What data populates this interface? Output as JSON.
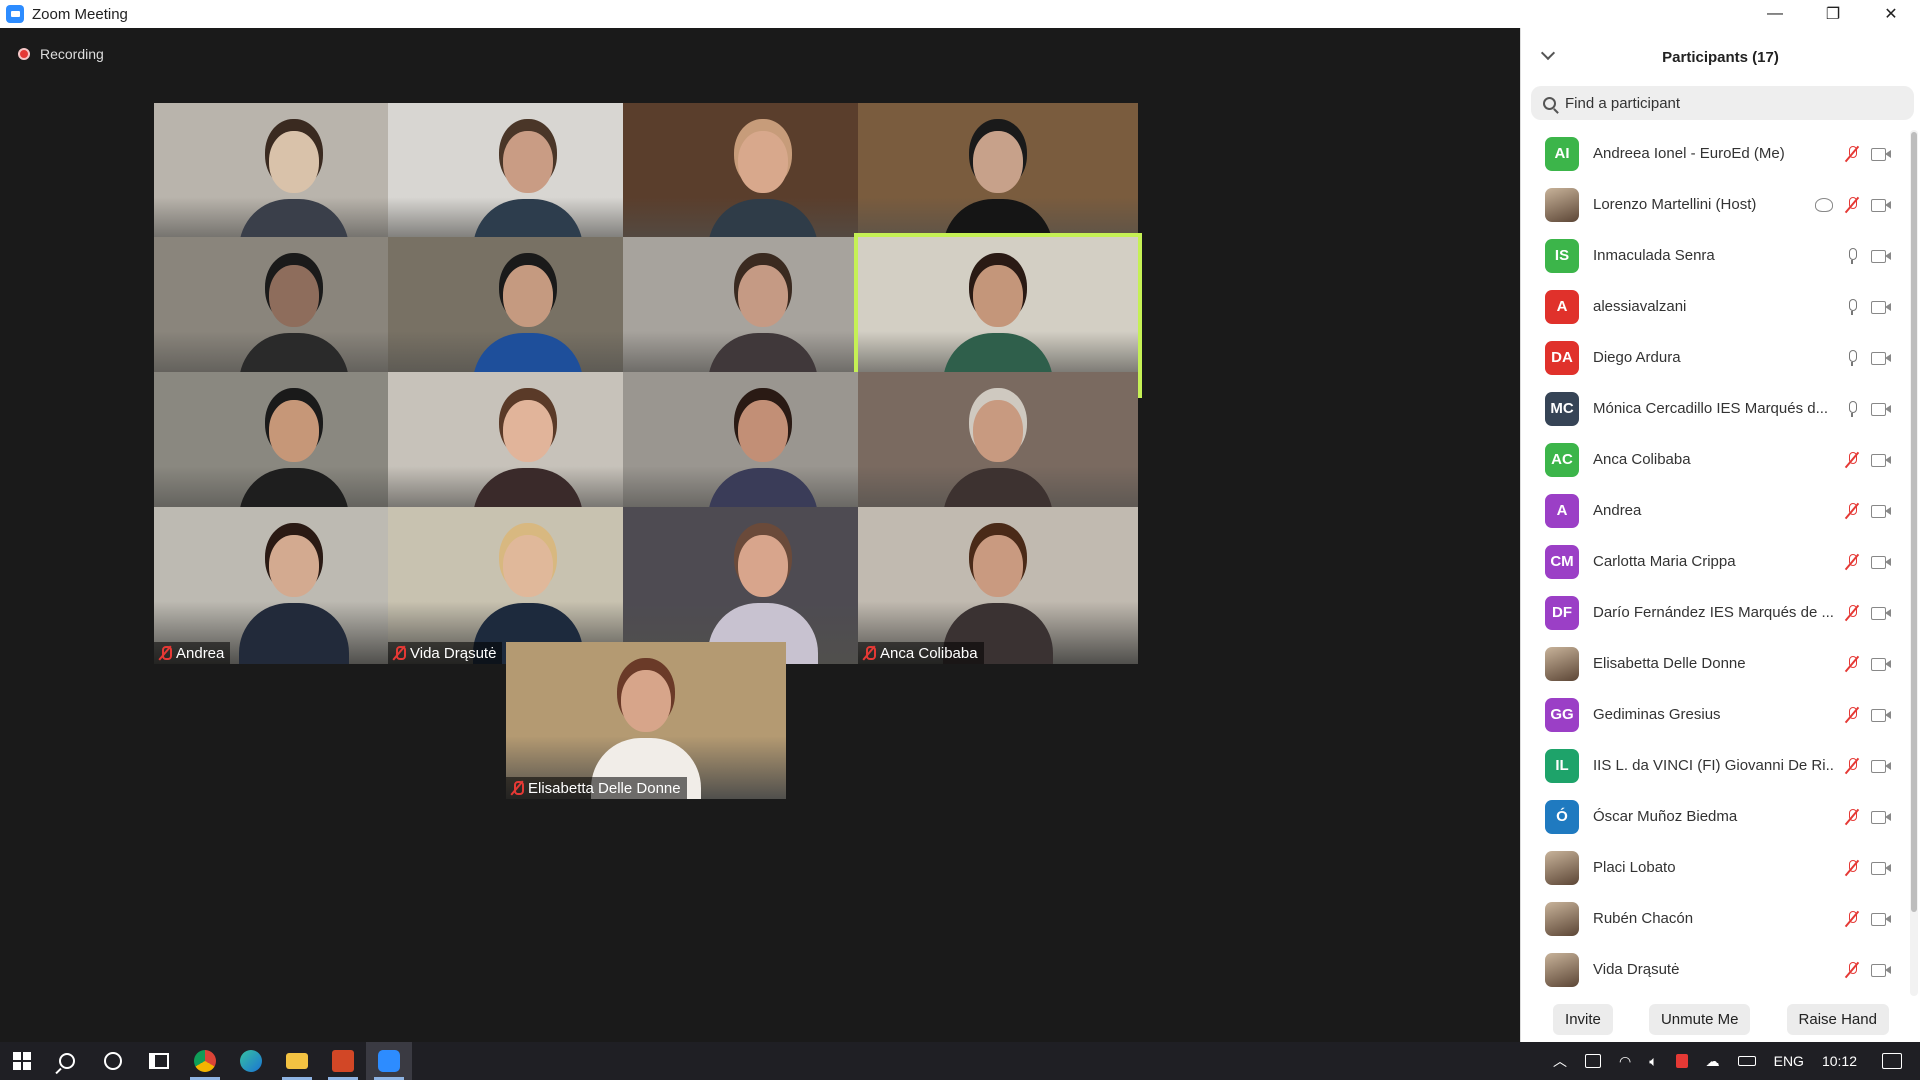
{
  "window": {
    "title": "Zoom Meeting",
    "minimize": "—",
    "restore": "❐",
    "close": "✕"
  },
  "meeting": {
    "recording_label": "Recording"
  },
  "tiles": [
    {
      "name": "Lorenzo Martellini",
      "muted": true
    },
    {
      "name": "Andreea Ionel - EuroEd",
      "muted": true
    },
    {
      "name": "Darío Fernández IES ...",
      "muted": true
    },
    {
      "name": "Placi Lobato",
      "muted": true
    },
    {
      "name": "IIS L. da VINCI (FI) Gio...",
      "muted": true
    },
    {
      "name": "Óscar Muñoz Biedma",
      "muted": true
    },
    {
      "name": "Mónica Cercadillo IES Ma...",
      "muted": false
    },
    {
      "name": "Inmaculada Senra",
      "muted": false
    },
    {
      "name": "Gediminas Gresius",
      "muted": true
    },
    {
      "name": "Carlotta Maria Crippa",
      "muted": true
    },
    {
      "name": "Diego Ardura",
      "muted": false
    },
    {
      "name": "Rubén Chacón",
      "muted": true
    },
    {
      "name": "Andrea",
      "muted": true
    },
    {
      "name": "Vida Drąsutė",
      "muted": true
    },
    {
      "name": "alessiavalzani",
      "muted": false
    },
    {
      "name": "Anca Colibaba",
      "muted": true
    },
    {
      "name": "Elisabetta Delle Donne",
      "muted": true
    }
  ],
  "participants_panel": {
    "title": "Participants (17)",
    "search_placeholder": "Find a participant",
    "participants": [
      {
        "initials": "AI",
        "name": "Andreea Ionel - EuroEd (Me)",
        "color": "#3cb54a",
        "mic": "muted"
      },
      {
        "initials": "",
        "name": "Lorenzo Martellini (Host)",
        "color": "photo",
        "mic": "muted"
      },
      {
        "initials": "IS",
        "name": "Inmaculada Senra",
        "color": "#3cb54a",
        "mic": "on"
      },
      {
        "initials": "A",
        "name": "alessiavalzani",
        "color": "#e0312b",
        "mic": "on"
      },
      {
        "initials": "DA",
        "name": "Diego Ardura",
        "color": "#e0312b",
        "mic": "on"
      },
      {
        "initials": "MC",
        "name": "Mónica Cercadillo IES Marqués d...",
        "color": "#364456",
        "mic": "on"
      },
      {
        "initials": "AC",
        "name": "Anca Colibaba",
        "color": "#3cb54a",
        "mic": "muted"
      },
      {
        "initials": "A",
        "name": "Andrea",
        "color": "#9b3fc6",
        "mic": "muted"
      },
      {
        "initials": "CM",
        "name": "Carlotta Maria Crippa",
        "color": "#9b3fc6",
        "mic": "muted"
      },
      {
        "initials": "DF",
        "name": "Darío Fernández IES Marqués de ...",
        "color": "#9b3fc6",
        "mic": "muted"
      },
      {
        "initials": "",
        "name": "Elisabetta Delle Donne",
        "color": "photo",
        "mic": "muted"
      },
      {
        "initials": "GG",
        "name": "Gediminas Gresius",
        "color": "#9b3fc6",
        "mic": "muted"
      },
      {
        "initials": "IL",
        "name": "IIS L. da VINCI (FI) Giovanni De Ri...",
        "color": "#1ea36a",
        "mic": "muted"
      },
      {
        "initials": "Ó",
        "name": "Óscar Muñoz Biedma",
        "color": "#1f7ac0",
        "mic": "muted"
      },
      {
        "initials": "",
        "name": "Placi Lobato",
        "color": "photo",
        "mic": "muted"
      },
      {
        "initials": "",
        "name": "Rubén Chacón",
        "color": "photo",
        "mic": "muted"
      },
      {
        "initials": "",
        "name": "Vida Drąsutė",
        "color": "photo",
        "mic": "muted"
      }
    ],
    "buttons": {
      "invite": "Invite",
      "unmute": "Unmute Me",
      "raise_hand": "Raise Hand"
    }
  },
  "taskbar": {
    "apps": [
      "chrome",
      "edge",
      "file-explorer",
      "powerpoint",
      "zoom"
    ],
    "language": "ENG",
    "time": "10:12"
  }
}
